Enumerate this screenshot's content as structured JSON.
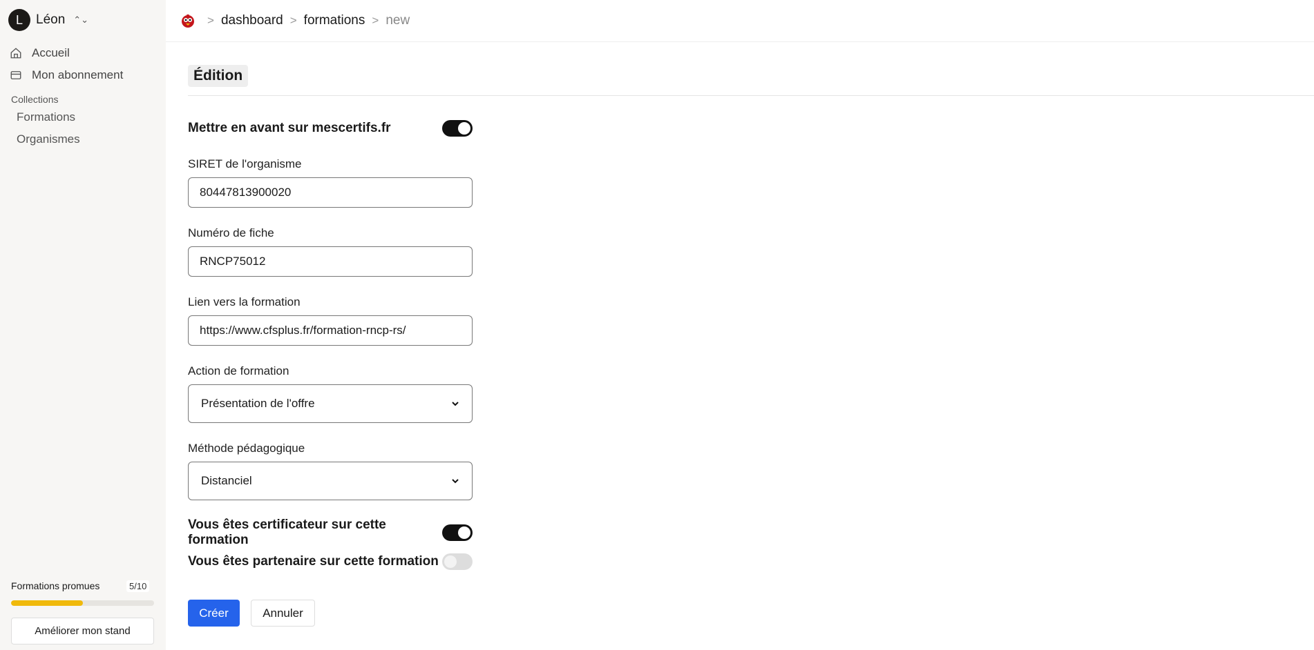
{
  "user": {
    "initial": "L",
    "name": "Léon"
  },
  "sidebar": {
    "nav": [
      {
        "label": "Accueil",
        "icon": "home-icon"
      },
      {
        "label": "Mon abonnement",
        "icon": "card-icon"
      }
    ],
    "collections_label": "Collections",
    "collections": [
      "Formations",
      "Organismes"
    ],
    "promo": {
      "label": "Formations promues",
      "count": "5/10",
      "progress": 0.5
    },
    "upgrade_label": "Améliorer mon stand"
  },
  "breadcrumb": {
    "items": [
      "dashboard",
      "formations"
    ],
    "current": "new"
  },
  "form": {
    "section_title": "Édition",
    "highlight_toggle": {
      "label": "Mettre en avant sur mescertifs.fr",
      "on": true
    },
    "siret": {
      "label": "SIRET de l'organisme",
      "value": "80447813900020"
    },
    "fiche": {
      "label": "Numéro de fiche",
      "value": "RNCP75012"
    },
    "lien": {
      "label": "Lien vers la formation",
      "value": "https://www.cfsplus.fr/formation-rncp-rs/"
    },
    "action": {
      "label": "Action de formation",
      "value": "Présentation de l'offre"
    },
    "methode": {
      "label": "Méthode pédagogique",
      "value": "Distanciel"
    },
    "certificateur_toggle": {
      "label": "Vous êtes certificateur sur cette formation",
      "on": true
    },
    "partenaire_toggle": {
      "label": "Vous êtes partenaire sur cette formation",
      "on": false
    },
    "submit_label": "Créer",
    "cancel_label": "Annuler"
  },
  "colors": {
    "primary": "#2563eb",
    "progress": "#f0b90b",
    "sidebar_bg": "#f7f6f4"
  }
}
